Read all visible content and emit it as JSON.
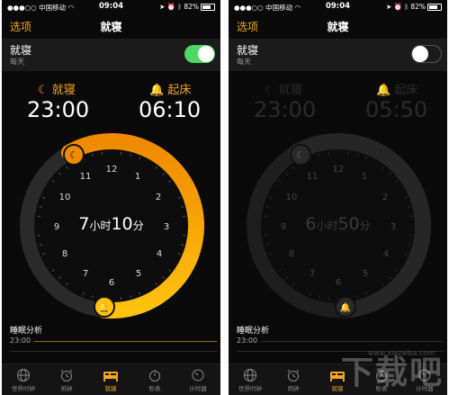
{
  "phones": [
    {
      "status": {
        "carrier": "中国移动",
        "time": "09:04",
        "battery": "82%"
      },
      "nav": {
        "options": "选项",
        "title": "就寝"
      },
      "bedtime_row": {
        "label": "就寝",
        "sub": "每天",
        "switch_on": true
      },
      "bedtime": {
        "label": "就寝",
        "time": "23:00"
      },
      "wake": {
        "label": "起床",
        "time": "06:10"
      },
      "duration": {
        "hours": "7",
        "hour_unit": "小时",
        "minutes": "10",
        "minute_unit": "分"
      },
      "dial_numbers": [
        "12",
        "1",
        "2",
        "3",
        "4",
        "5",
        "6",
        "7",
        "8",
        "9",
        "10",
        "11"
      ],
      "analysis": {
        "title": "睡眠分析",
        "time": "23:00"
      },
      "tabs": [
        {
          "label": "世界时钟",
          "icon": "globe-icon",
          "active": false
        },
        {
          "label": "闹钟",
          "icon": "alarm-clock-icon",
          "active": false
        },
        {
          "label": "就寝",
          "icon": "bed-icon",
          "active": true
        },
        {
          "label": "秒表",
          "icon": "stopwatch-icon",
          "active": false
        },
        {
          "label": "计时器",
          "icon": "timer-icon",
          "active": false
        }
      ]
    },
    {
      "status": {
        "carrier": "中国移动",
        "time": "09:04",
        "battery": "82%"
      },
      "nav": {
        "options": "选项",
        "title": "就寝"
      },
      "bedtime_row": {
        "label": "就寝",
        "sub": "每天",
        "switch_on": false
      },
      "bedtime": {
        "label": "就寝",
        "time": "23:00"
      },
      "wake": {
        "label": "起床",
        "time": "05:50"
      },
      "duration": {
        "hours": "6",
        "hour_unit": "小时",
        "minutes": "50",
        "minute_unit": "分"
      },
      "dial_numbers": [
        "12",
        "1",
        "2",
        "3",
        "4",
        "5",
        "6",
        "7",
        "8",
        "9",
        "10",
        "11"
      ],
      "analysis": {
        "title": "睡眠分析",
        "time": "23:00"
      },
      "tabs": [
        {
          "label": "世界时钟",
          "icon": "globe-icon",
          "active": false
        },
        {
          "label": "闹钟",
          "icon": "alarm-clock-icon",
          "active": false
        },
        {
          "label": "就寝",
          "icon": "bed-icon",
          "active": true
        },
        {
          "label": "秒表",
          "icon": "stopwatch-icon",
          "active": false
        },
        {
          "label": "计时器",
          "icon": "timer-icon",
          "active": false
        }
      ]
    }
  ],
  "watermark": {
    "text": "下载吧",
    "url": "www.xiazaiba.com"
  },
  "colors": {
    "accent": "#f5a623",
    "switch_on": "#4cd964",
    "background": "#0a0a0a"
  }
}
